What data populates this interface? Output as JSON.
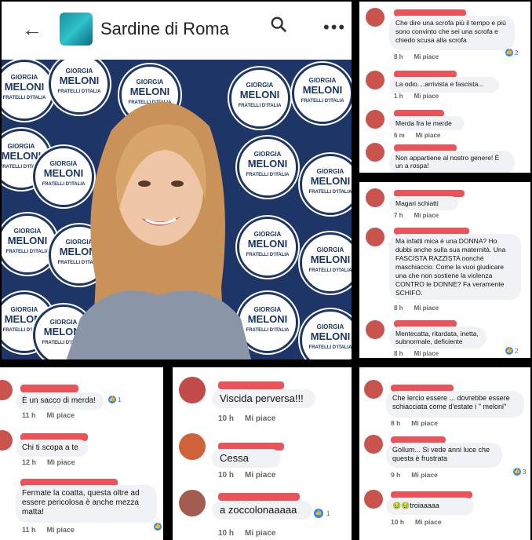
{
  "header": {
    "back_icon": "arrow-left-icon",
    "title": "Sardine di Roma",
    "search_icon": "search-icon",
    "more_icon": "more-icon"
  },
  "poster": {
    "line1": "GIORGIA",
    "line2": "MELONI",
    "line3": "FRATELLI D'ITALIA"
  },
  "panel_top_right": [
    {
      "text": "Che dire una scrofa più il tempo e più sono convinto che sei una scrofa e chiedo scusa alla scrofa",
      "time": "8 h",
      "like": "Mi piace",
      "reaction": "2"
    },
    {
      "text": "La odio....arrivista e fascista...",
      "time": "1 h",
      "like": "Mi piace"
    },
    {
      "text": "Merda fra le merde",
      "time": "6 m",
      "like": "Mi piace"
    },
    {
      "text": "Non appartiene al nostro genere! È un a rospa!"
    }
  ],
  "panel_mid_right": [
    {
      "text": "Magari schiatti",
      "time": "7 h",
      "like": "Mi piace"
    },
    {
      "text": "Ma infatti mica è una DONNA? Ho dubbi anche sulla sua maternità. Una FASCISTA RAZZISTA nonché maschiaccio. Come la vuoi giudicare una che non sostiene la violenza CONTRO le DONNE? Fa veramente SCHIFO.",
      "time": "8 h",
      "like": "Mi piace"
    },
    {
      "text": "Mentecatta, ritardata, inetta, subnormale, deficiente",
      "time": "8 h",
      "like": "Mi piace",
      "reaction": "2"
    }
  ],
  "panel_bottom_left": [
    {
      "text": "È un sacco di merda!",
      "time": "11 h",
      "like": "Mi piace",
      "reaction": "1"
    },
    {
      "text": "Chi ti scopa a te",
      "time": "12 h",
      "like": "Mi piace"
    },
    {
      "text": "Fermate la coatta, questa oltre ad essere pericolosa è anche mezza matta!",
      "time": "11 h",
      "like": "Mi piace"
    }
  ],
  "panel_bottom_mid": [
    {
      "text": "Viscida perversa!!!",
      "time": "10 h",
      "like": "Mi piace"
    },
    {
      "text": "Cessa",
      "time": "10 h",
      "like": "Mi piace"
    },
    {
      "text": "a zoccolonaaaaa",
      "time": "10 h",
      "like": "Mi piace",
      "reaction": "1"
    }
  ],
  "panel_bottom_right": [
    {
      "text": "Che lercio essere ... dovrebbe essere schiacciata come d'estate i \" meloni\"",
      "time": "8 h",
      "like": "Mi piace"
    },
    {
      "text": "Gollum... Si vede anni luce che questa è frustrata",
      "time": "9 h",
      "like": "Mi piace",
      "reaction": "3"
    },
    {
      "text": "🤢🤢troiaaaaa",
      "time": "10 h",
      "like": "Mi piace"
    }
  ]
}
